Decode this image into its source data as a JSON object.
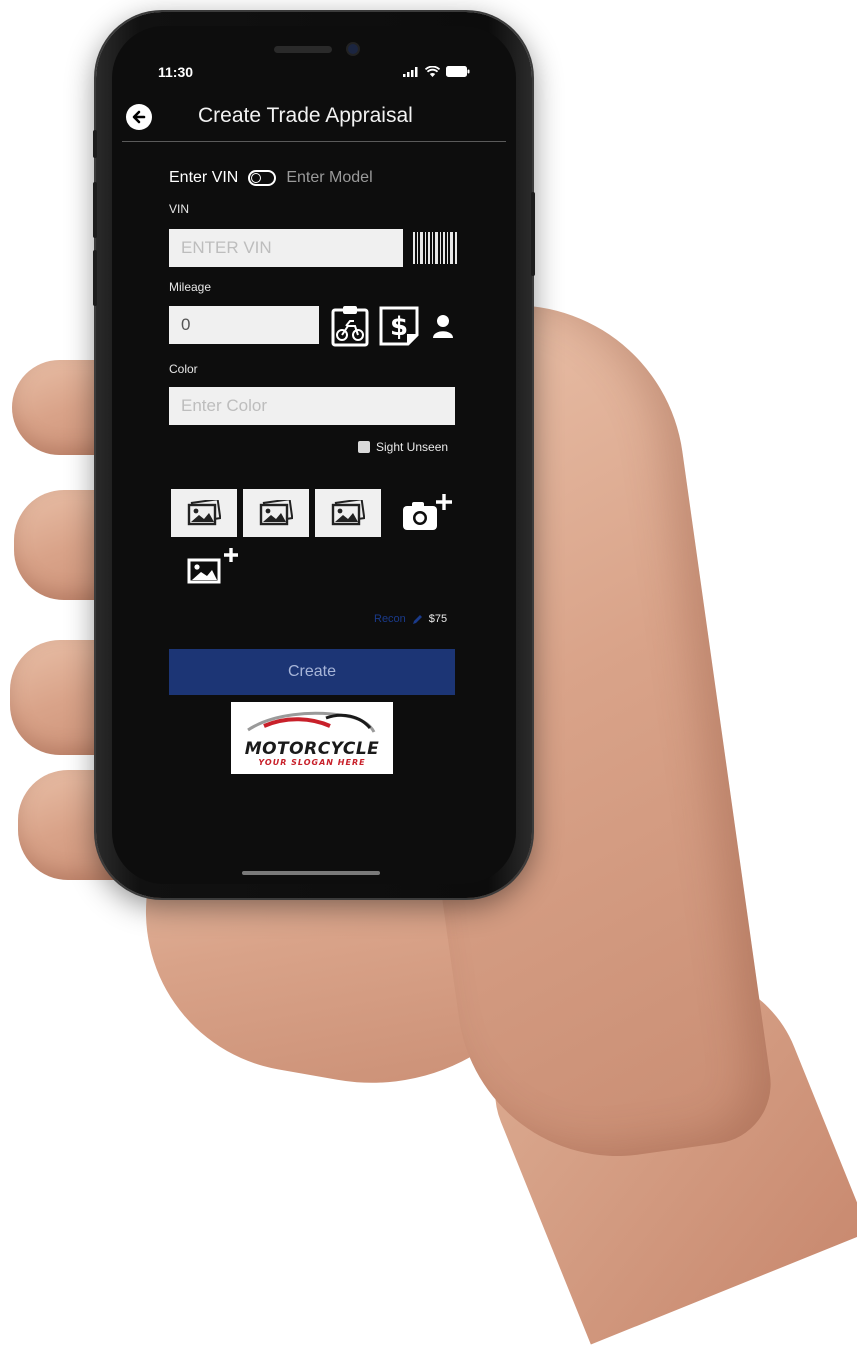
{
  "status_bar": {
    "time": "11:30",
    "icons": [
      "signal-icon",
      "wifi-icon",
      "battery-icon"
    ]
  },
  "header": {
    "back_icon": "back-arrow-icon",
    "title": "Create Trade Appraisal"
  },
  "mode_switch": {
    "left_label": "Enter VIN",
    "right_label": "Enter Model",
    "selected": "Enter VIN"
  },
  "vin": {
    "label": "VIN",
    "value": "",
    "placeholder": "ENTER VIN",
    "scan_icon": "barcode-icon"
  },
  "mileage": {
    "label": "Mileage",
    "value": "0",
    "icons": [
      "clipboard-motorcycle-icon",
      "dollar-document-icon",
      "user-icon"
    ]
  },
  "color": {
    "label": "Color",
    "value": "",
    "placeholder": "Enter Color"
  },
  "sight_unseen": {
    "label": "Sight Unseen",
    "checked": false
  },
  "photos": {
    "thumbnails": [
      "image-placeholder-icon",
      "image-placeholder-icon",
      "image-placeholder-icon"
    ],
    "add_camera_icon": "camera-add-icon",
    "add_gallery_icon": "gallery-add-icon"
  },
  "recon": {
    "link_label": "Recon",
    "edit_icon": "pencil-icon",
    "amount": "$75"
  },
  "actions": {
    "create_label": "Create"
  },
  "logo": {
    "word": "MOTORCYCLE",
    "slogan": "YOUR SLOGAN HERE"
  },
  "colors": {
    "screen_bg": "#0d0d0d",
    "input_bg": "#f0f0f0",
    "primary_button": "#1c3575",
    "recon_link": "#1a3a8a",
    "logo_red": "#c8202a"
  }
}
